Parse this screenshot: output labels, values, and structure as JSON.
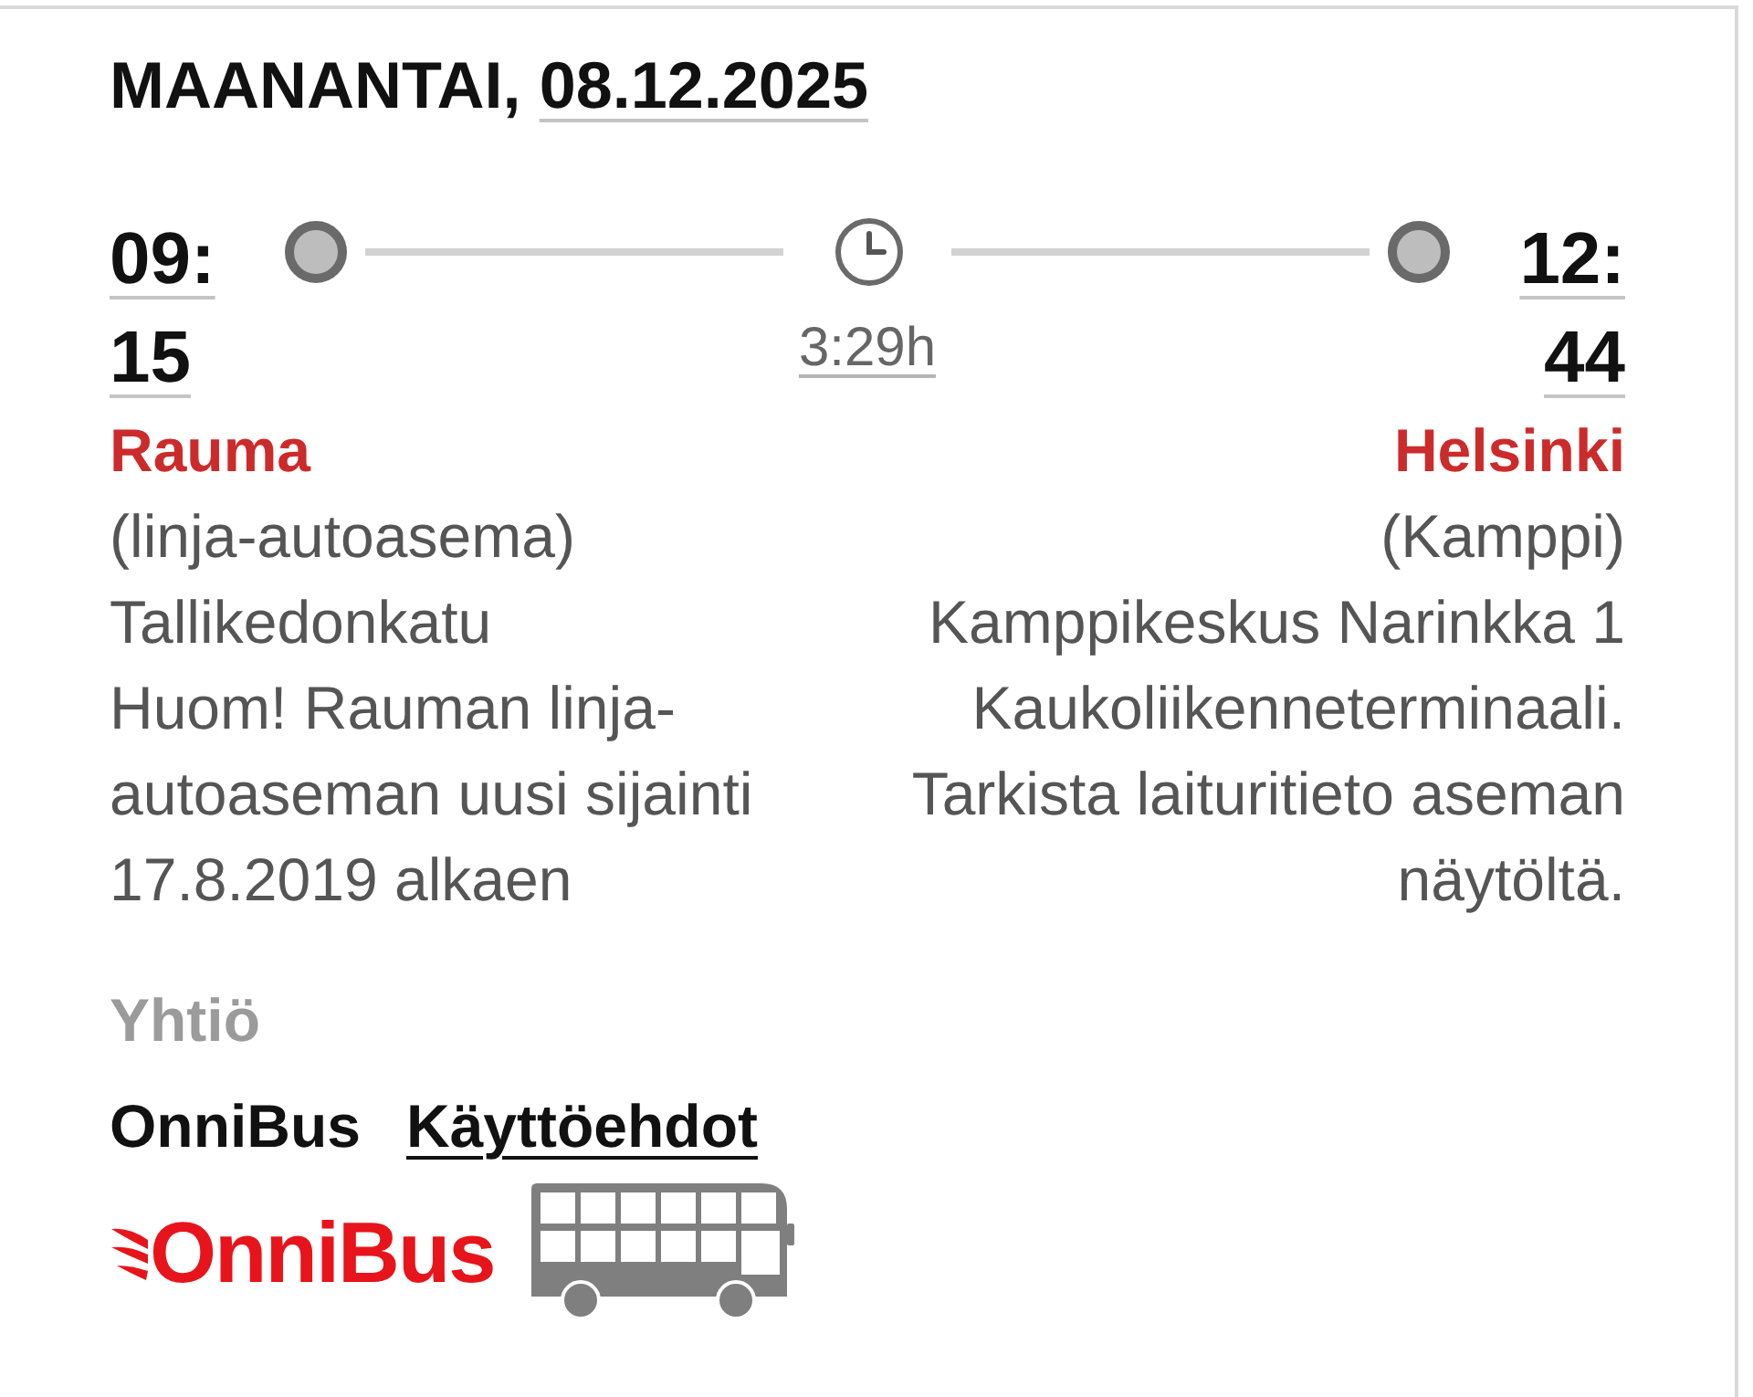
{
  "date_header": {
    "weekday": "MAANANTAI,",
    "date": "08.12.2025"
  },
  "departure": {
    "time": "09:15",
    "station": "Rauma",
    "details": [
      "(linja-autoasema)",
      "Tallikedonkatu",
      "Huom! Rauman linja-autoaseman uusi sijainti 17.8.2019 alkaen"
    ]
  },
  "duration": "3:29h",
  "arrival": {
    "time": "12:44",
    "station": "Helsinki",
    "details": [
      "(Kamppi)",
      "Kamppikeskus Narinkka 1",
      "Kaukoliikenneterminaali. Tarkista laituritieto aseman näytöltä."
    ]
  },
  "company": {
    "heading": "Yhtiö",
    "name": "OnniBus",
    "terms_link": "Käyttöehdot",
    "logo_text": "OnniBus"
  }
}
